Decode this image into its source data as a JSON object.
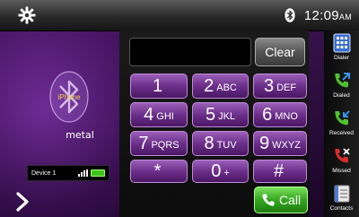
{
  "status": {
    "clock": "12:09",
    "ampm": "AM"
  },
  "device": {
    "bt_label": "iPhone",
    "name": "metal",
    "slot": "Device 1"
  },
  "keypad": {
    "clear_label": "Clear",
    "keys": [
      {
        "num": "1",
        "letters": ""
      },
      {
        "num": "2",
        "letters": "ABC"
      },
      {
        "num": "3",
        "letters": "DEF"
      },
      {
        "num": "4",
        "letters": "GHI"
      },
      {
        "num": "5",
        "letters": "JKL"
      },
      {
        "num": "6",
        "letters": "MNO"
      },
      {
        "num": "7",
        "letters": "PQRS"
      },
      {
        "num": "8",
        "letters": "TUV"
      },
      {
        "num": "9",
        "letters": "WXYZ"
      },
      {
        "num": "*",
        "letters": ""
      },
      {
        "num": "0",
        "letters": "+"
      },
      {
        "num": "#",
        "letters": ""
      }
    ],
    "call_label": "Call"
  },
  "nav": [
    {
      "label": "Dialer",
      "icon": "dialer-icon"
    },
    {
      "label": "Dialed",
      "icon": "dialed-icon"
    },
    {
      "label": "Received",
      "icon": "received-icon"
    },
    {
      "label": "Missed",
      "icon": "missed-icon"
    },
    {
      "label": "Contacts",
      "icon": "contacts-icon"
    }
  ],
  "colors": {
    "accent": "#6c2f8b",
    "call": "#34a51f",
    "missed": "#d92b2b"
  }
}
